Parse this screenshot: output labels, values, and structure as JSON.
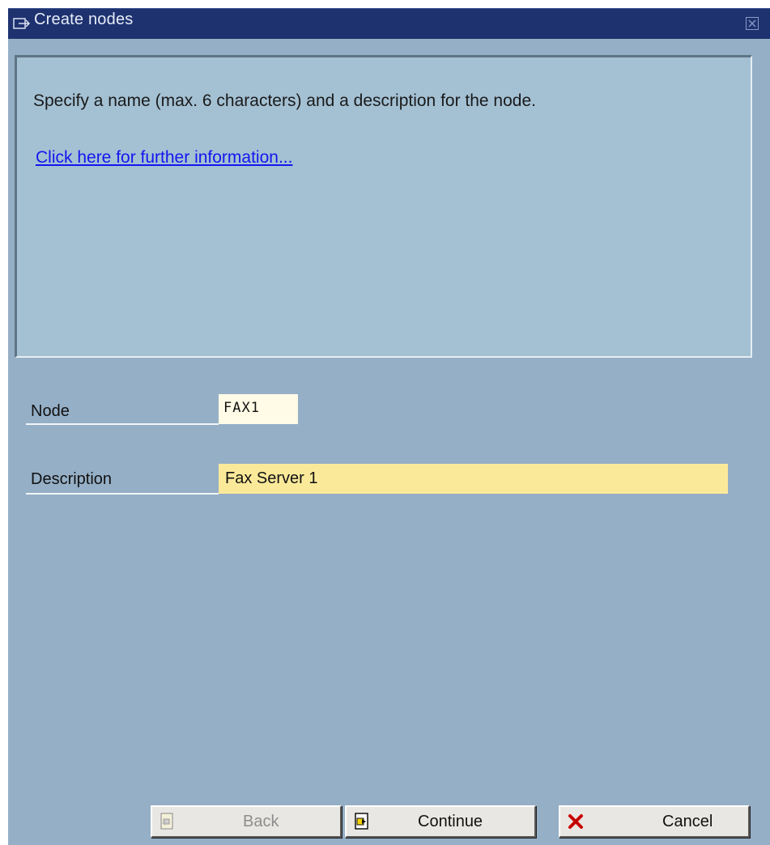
{
  "window": {
    "title": "Create nodes",
    "title_icon": "dialog-window-icon",
    "close_icon": "close-icon"
  },
  "info_panel": {
    "message": "Specify a name (max. 6 characters) and a description for the node.",
    "link_text": "Click here for further information..."
  },
  "form": {
    "node_label": "Node",
    "node_value": "FAX1",
    "description_label": "Description",
    "description_value": "Fax Server 1"
  },
  "buttons": {
    "back_label": "Back",
    "continue_label": "Continue",
    "cancel_label": "Cancel"
  },
  "colors": {
    "titlebar": "#1e3270",
    "background": "#95afc6",
    "info_panel": "#a4c1d4",
    "required_field": "#fbe99a",
    "link": "#1515ee"
  }
}
